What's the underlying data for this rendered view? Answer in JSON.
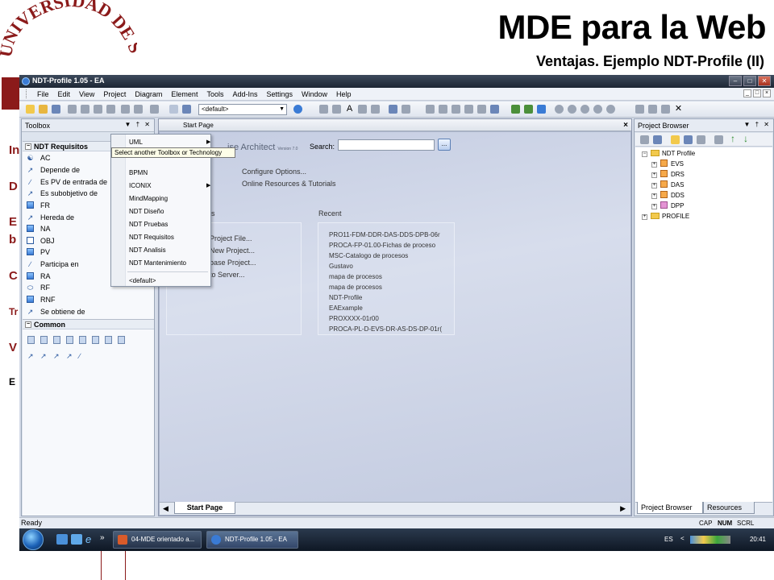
{
  "slide": {
    "title": "MDE para la Web",
    "subtitle": "Ventajas. Ejemplo NDT-Profile (II)",
    "seal_text": "UNIVERSIDAD DE SE",
    "bullets_fragments": [
      "In",
      "D",
      "E",
      "b",
      "C",
      "Tr",
      "V",
      "E"
    ]
  },
  "window": {
    "title": "NDT-Profile 1.05 - EA",
    "menu": [
      "File",
      "Edit",
      "View",
      "Project",
      "Diagram",
      "Element",
      "Tools",
      "Add-Ins",
      "Settings",
      "Window",
      "Help"
    ],
    "toolbar_select": "<default>"
  },
  "toolbox": {
    "title": "Toolbox",
    "section1": "NDT Requisitos",
    "items": [
      "AC",
      "Depende de",
      "Es PV de entrada de",
      "Es subobjetivo de",
      "FR",
      "Hereda de",
      "NA",
      "OBJ",
      "PV",
      "Participa en",
      "RA",
      "RF",
      "RNF",
      "Se obtiene de"
    ],
    "section2": "Common"
  },
  "dropdown": {
    "items": [
      "UML",
      "BPMN",
      "ICONIX",
      "MindMapping",
      "NDT Diseño",
      "NDT Pruebas",
      "NDT Requisitos",
      "NDT Analisis",
      "NDT Mantenimiento",
      "<default>"
    ],
    "tooltip": "Select another Toolbox or Technology"
  },
  "startpage": {
    "tab_title": "Start Page",
    "brand": "ise Architect",
    "brand_version": "Version 7.0",
    "search_label": "Search:",
    "search_go": "...",
    "options": [
      "Configure Options...",
      "Online Resources & Tutorials"
    ],
    "projects_header": "ects",
    "projects": [
      "Project File...",
      "New Project...",
      "base Project...",
      "to Server..."
    ],
    "recent_header": "Recent",
    "recent": [
      "PRO11-FDM-DDR-DAS-DDS-DPB-06r",
      "PROCA-FP-01.00-Fichas de proceso",
      "MSC-Catalogo de procesos",
      "Gustavo",
      "mapa de procesos",
      "mapa de procesos",
      "NDT-Profile",
      "EAExample",
      "PROXXXX-01r00",
      "PROCA-PL-D-EVS-DR-AS-DS-DP-01r("
    ],
    "bottom_tab": "Start Page"
  },
  "project_browser": {
    "title": "Project Browser",
    "root": "NDT Profile",
    "children": [
      "EVS",
      "DRS",
      "DAS",
      "DDS",
      "DPP"
    ],
    "profile": "PROFILE",
    "tab_active": "Project Browser",
    "tab_other": "Resources"
  },
  "status": {
    "text": "Ready",
    "indicators": [
      "CAP",
      "NUM",
      "SCRL"
    ]
  },
  "taskbar": {
    "tasks": [
      "04-MDE orientado a...",
      "NDT-Profile 1.05 - EA"
    ],
    "lang": "ES",
    "clock": "20:41"
  }
}
